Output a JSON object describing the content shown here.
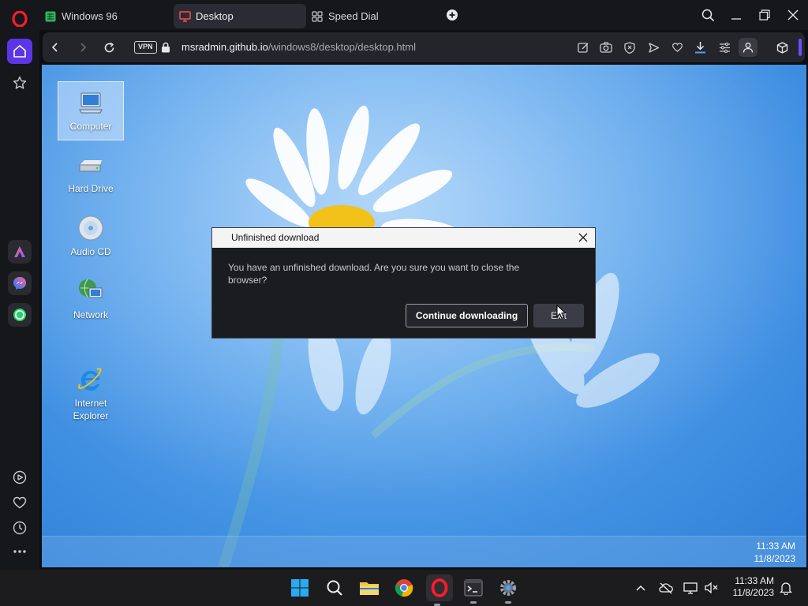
{
  "browser": {
    "tabs": [
      {
        "label": "Windows 96",
        "icon": "spreadsheet-green-icon"
      },
      {
        "label": "Desktop",
        "icon": "monitor-icon",
        "active": true
      },
      {
        "label": "Speed Dial",
        "icon": "grid-icon"
      }
    ],
    "vpn_label": "VPN",
    "url_host": "msradmin.github.io",
    "url_path": "/windows8/desktop/desktop.html",
    "accent": "#5b35e6"
  },
  "desktop": {
    "icons": [
      {
        "label": "Computer"
      },
      {
        "label": "Hard Drive"
      },
      {
        "label": "Audio CD"
      },
      {
        "label": "Network"
      },
      {
        "label": "Internet\nExplorer"
      }
    ],
    "clock_time": "11:33 AM",
    "clock_date": "11/8/2023"
  },
  "dialog": {
    "title": "Unfinished download",
    "message": "You have an unfinished download. Are you sure you want to close the browser?",
    "primary_button": "Continue downloading",
    "secondary_button": "Exit"
  },
  "host_taskbar": {
    "clock_time": "11:33 AM",
    "clock_date": "11/8/2023"
  }
}
